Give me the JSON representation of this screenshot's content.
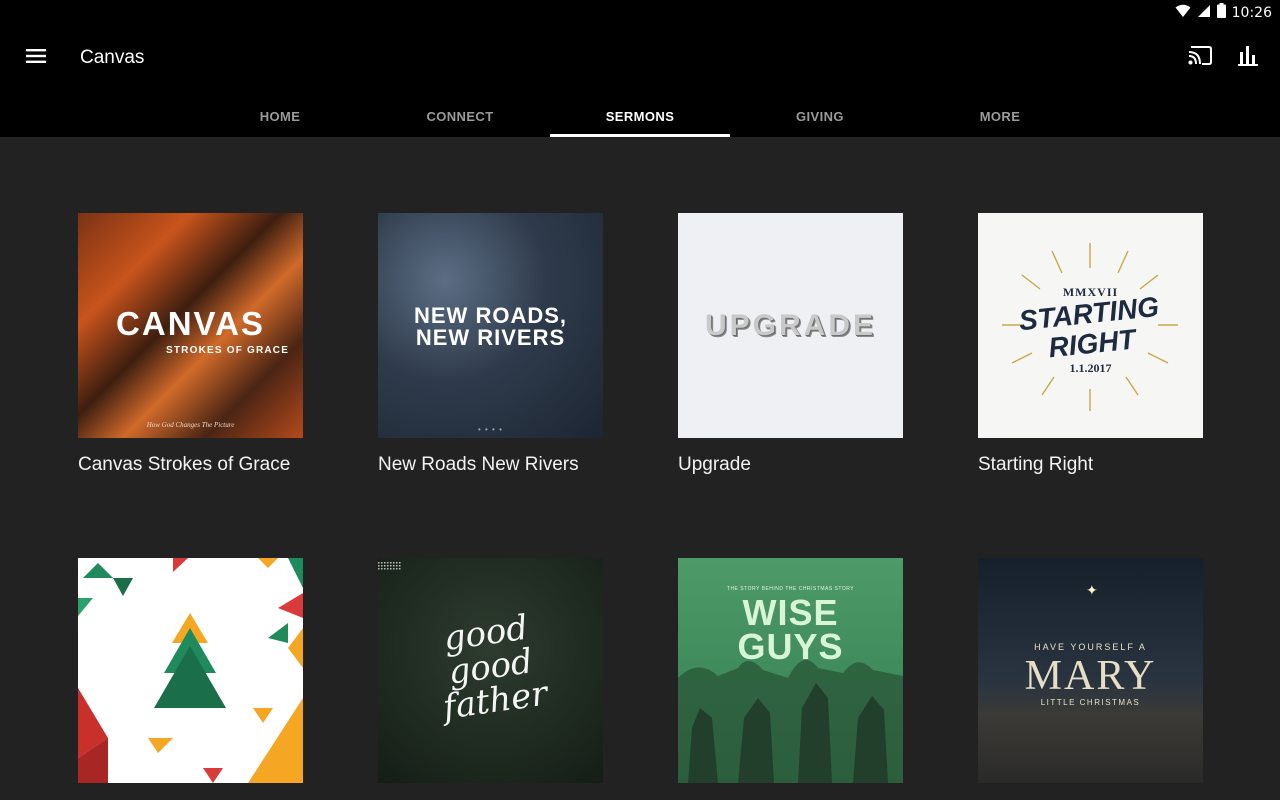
{
  "status_bar": {
    "time": "10:26",
    "icons": [
      "wifi-icon",
      "signal-icon",
      "battery-icon"
    ]
  },
  "app_bar": {
    "title": "Canvas",
    "icons": [
      "menu-icon",
      "cast-icon",
      "stats-icon"
    ]
  },
  "tabs": [
    {
      "label": "HOME",
      "active": false
    },
    {
      "label": "CONNECT",
      "active": false
    },
    {
      "label": "SERMONS",
      "active": true
    },
    {
      "label": "GIVING",
      "active": false
    },
    {
      "label": "MORE",
      "active": false
    }
  ],
  "sermons": [
    {
      "title": "Canvas Strokes of Grace",
      "artwork": {
        "big": "CANVAS",
        "sub": "STROKES OF GRACE",
        "tagline": "How God Changes The Picture"
      }
    },
    {
      "title": "New Roads New Rivers",
      "artwork": {
        "line1": "NEW ROADS,",
        "line2": "NEW RIVERS",
        "dots": "• • • •"
      }
    },
    {
      "title": "Upgrade",
      "artwork": {
        "text": "UPGRADE"
      }
    },
    {
      "title": "Starting Right",
      "artwork": {
        "roman": "MMXVII",
        "line1": "STARTING",
        "line2": "RIGHT",
        "date": "1.1.2017"
      }
    },
    {
      "title": "",
      "artwork": {}
    },
    {
      "title": "",
      "artwork": {
        "line1": "good",
        "line2": "good",
        "line3": "father"
      }
    },
    {
      "title": "",
      "artwork": {
        "kicker": "THE STORY BEHIND THE CHRISTMAS STORY",
        "line1": "WISE",
        "line2": "GUYS"
      }
    },
    {
      "title": "",
      "artwork": {
        "have": "HAVE YOURSELF A",
        "big": "MARY",
        "little": "LITTLE CHRISTMAS"
      }
    }
  ],
  "colors": {
    "background": "#222222",
    "app_bar": "#000000",
    "tab_inactive": "#9a9a9a",
    "tab_active": "#ffffff"
  }
}
